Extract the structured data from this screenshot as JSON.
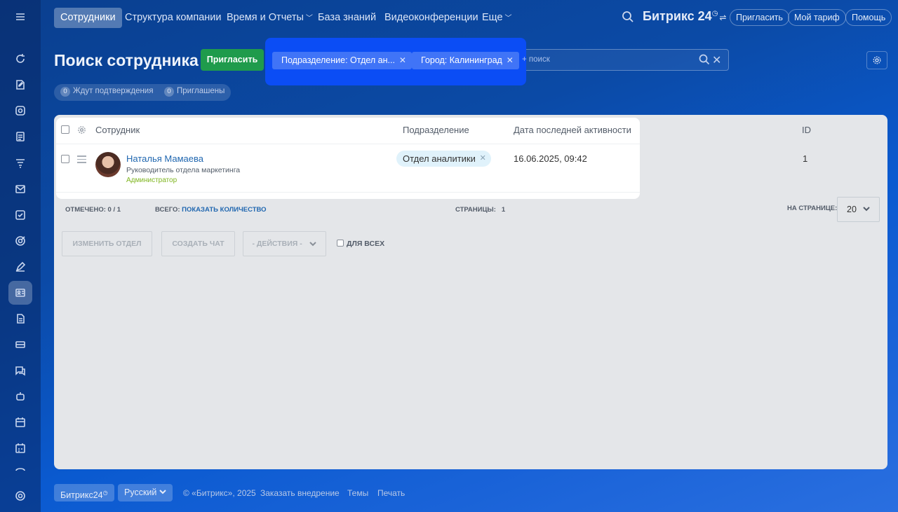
{
  "nav": {
    "items": [
      {
        "label": "Сотрудники",
        "active": true
      },
      {
        "label": "Структура компании"
      },
      {
        "label": "Время и Отчеты",
        "chevron": true
      },
      {
        "label": "База знаний"
      },
      {
        "label": "Видеоконференции"
      },
      {
        "label": "Еще",
        "chevron": true
      }
    ],
    "brand": "Битрикс 24",
    "invite": "Пригласить",
    "tariff": "Мой тариф",
    "help": "Помощь"
  },
  "sidebar_icons": [
    "menu-icon",
    "refresh-icon",
    "tasks-edit-icon",
    "camera-icon",
    "document-icon",
    "funnel-icon",
    "mail-icon",
    "checkbox-icon",
    "target-icon",
    "sign-icon",
    "employees-card-icon",
    "file-icon",
    "inbox-icon",
    "chat-icon",
    "robot-icon",
    "calendar-icon",
    "calendar-plan-icon",
    "shop-icon",
    "settings-icon"
  ],
  "page": {
    "title": "Поиск сотрудника",
    "invite_button": "Пригласить",
    "filters": [
      {
        "label": "Подразделение: Отдел ан..."
      },
      {
        "label": "Город: Калининград"
      }
    ],
    "search_placeholder": "+ поиск",
    "counters": [
      {
        "count": "0",
        "label": "Ждут подтверждения"
      },
      {
        "count": "0",
        "label": "Приглашены"
      }
    ]
  },
  "grid": {
    "columns": {
      "employee": "Сотрудник",
      "department": "Подразделение",
      "last_activity": "Дата последней активности",
      "id": "ID"
    },
    "rows": [
      {
        "name": "Наталья Мамаева",
        "position": "Руководитель отдела маркетинга",
        "role": "Администратор",
        "department": "Отдел аналитики",
        "last_activity": "16.06.2025, 09:42",
        "id": "1"
      }
    ],
    "footer": {
      "selected_label": "ОТМЕЧЕНО:",
      "selected_value": "0 / 1",
      "total_label": "ВСЕГО:",
      "total_link": "ПОКАЗАТЬ КОЛИЧЕСТВО",
      "pages_label": "СТРАНИЦЫ:",
      "pages_value": "1",
      "per_page_label": "НА СТРАНИЦЕ:",
      "per_page_value": "20"
    },
    "actions": {
      "change_dept": "ИЗМЕНИТЬ ОТДЕЛ",
      "create_chat": "СОЗДАТЬ ЧАТ",
      "actions_select": "- ДЕЙСТВИЯ -",
      "for_all": "ДЛЯ ВСЕХ"
    }
  },
  "footer": {
    "brand": "Битрикс24",
    "language": "Русский",
    "copyright": "© «Битрикс», 2025",
    "order": "Заказать внедрение",
    "themes": "Темы",
    "print": "Печать"
  }
}
